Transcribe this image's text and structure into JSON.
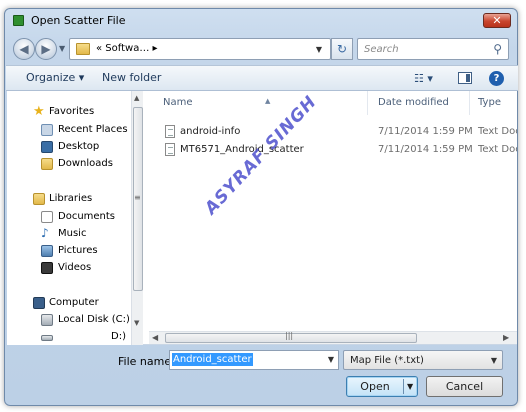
{
  "window": {
    "title": "Open Scatter File",
    "close_glyph": "✕"
  },
  "navigation": {
    "back_glyph": "◀",
    "forward_glyph": "▶",
    "address_text": "« Softwa… ▸",
    "refresh_glyph": "↻",
    "search_placeholder": "Search",
    "search_glyph": "⚲"
  },
  "toolbar": {
    "organize_label": "Organize ▾",
    "new_folder_label": "New folder",
    "views_glyph": "☷ ▾",
    "help_glyph": "?"
  },
  "sidebar": {
    "items": [
      {
        "label": "Favorites",
        "icon": "star-icon",
        "color": "#e8b21c"
      },
      {
        "label": "Recent Places",
        "icon": "recent-places-icon",
        "color": "#6f8fb3"
      },
      {
        "label": "Desktop",
        "icon": "desktop-icon",
        "color": "#3a6ea5"
      },
      {
        "label": "Downloads",
        "icon": "downloads-icon",
        "color": "#e2b84a"
      },
      {
        "label": "Libraries",
        "icon": "libraries-icon",
        "color": "#e2b84a"
      },
      {
        "label": "Documents",
        "icon": "documents-icon",
        "color": "#cfd8e3"
      },
      {
        "label": "Music",
        "icon": "music-icon",
        "color": "#2b6cb0"
      },
      {
        "label": "Pictures",
        "icon": "pictures-icon",
        "color": "#5a86b8"
      },
      {
        "label": "Videos",
        "icon": "videos-icon",
        "color": "#4a4a4a"
      },
      {
        "label": "Computer",
        "icon": "computer-icon",
        "color": "#3a5f8a"
      },
      {
        "label": "Local Disk (C:)",
        "icon": "disk-icon",
        "color": "#8a949e"
      },
      {
        "label": "D:)",
        "icon": "drive-icon",
        "color": "#8a949e"
      }
    ]
  },
  "file_list": {
    "columns": [
      "Name",
      "Date modified",
      "Type"
    ],
    "rows": [
      {
        "name": "android-info",
        "date": "7/11/2014 1:59 PM",
        "type": "Text Docu"
      },
      {
        "name": "MT6571_Android_scatter",
        "date": "7/11/2014 1:59 PM",
        "type": "Text Docu"
      }
    ]
  },
  "watermark": "ASYRAF SINGH",
  "footer": {
    "file_name_label": "File name:",
    "file_name_value": "Android_scatter",
    "filter_value": "Map File (*.txt)",
    "open_label": "Open",
    "cancel_label": "Cancel"
  },
  "colors": {
    "accent": "#3399ff",
    "watermark": "#4e50cd",
    "close": "#c9452e"
  }
}
